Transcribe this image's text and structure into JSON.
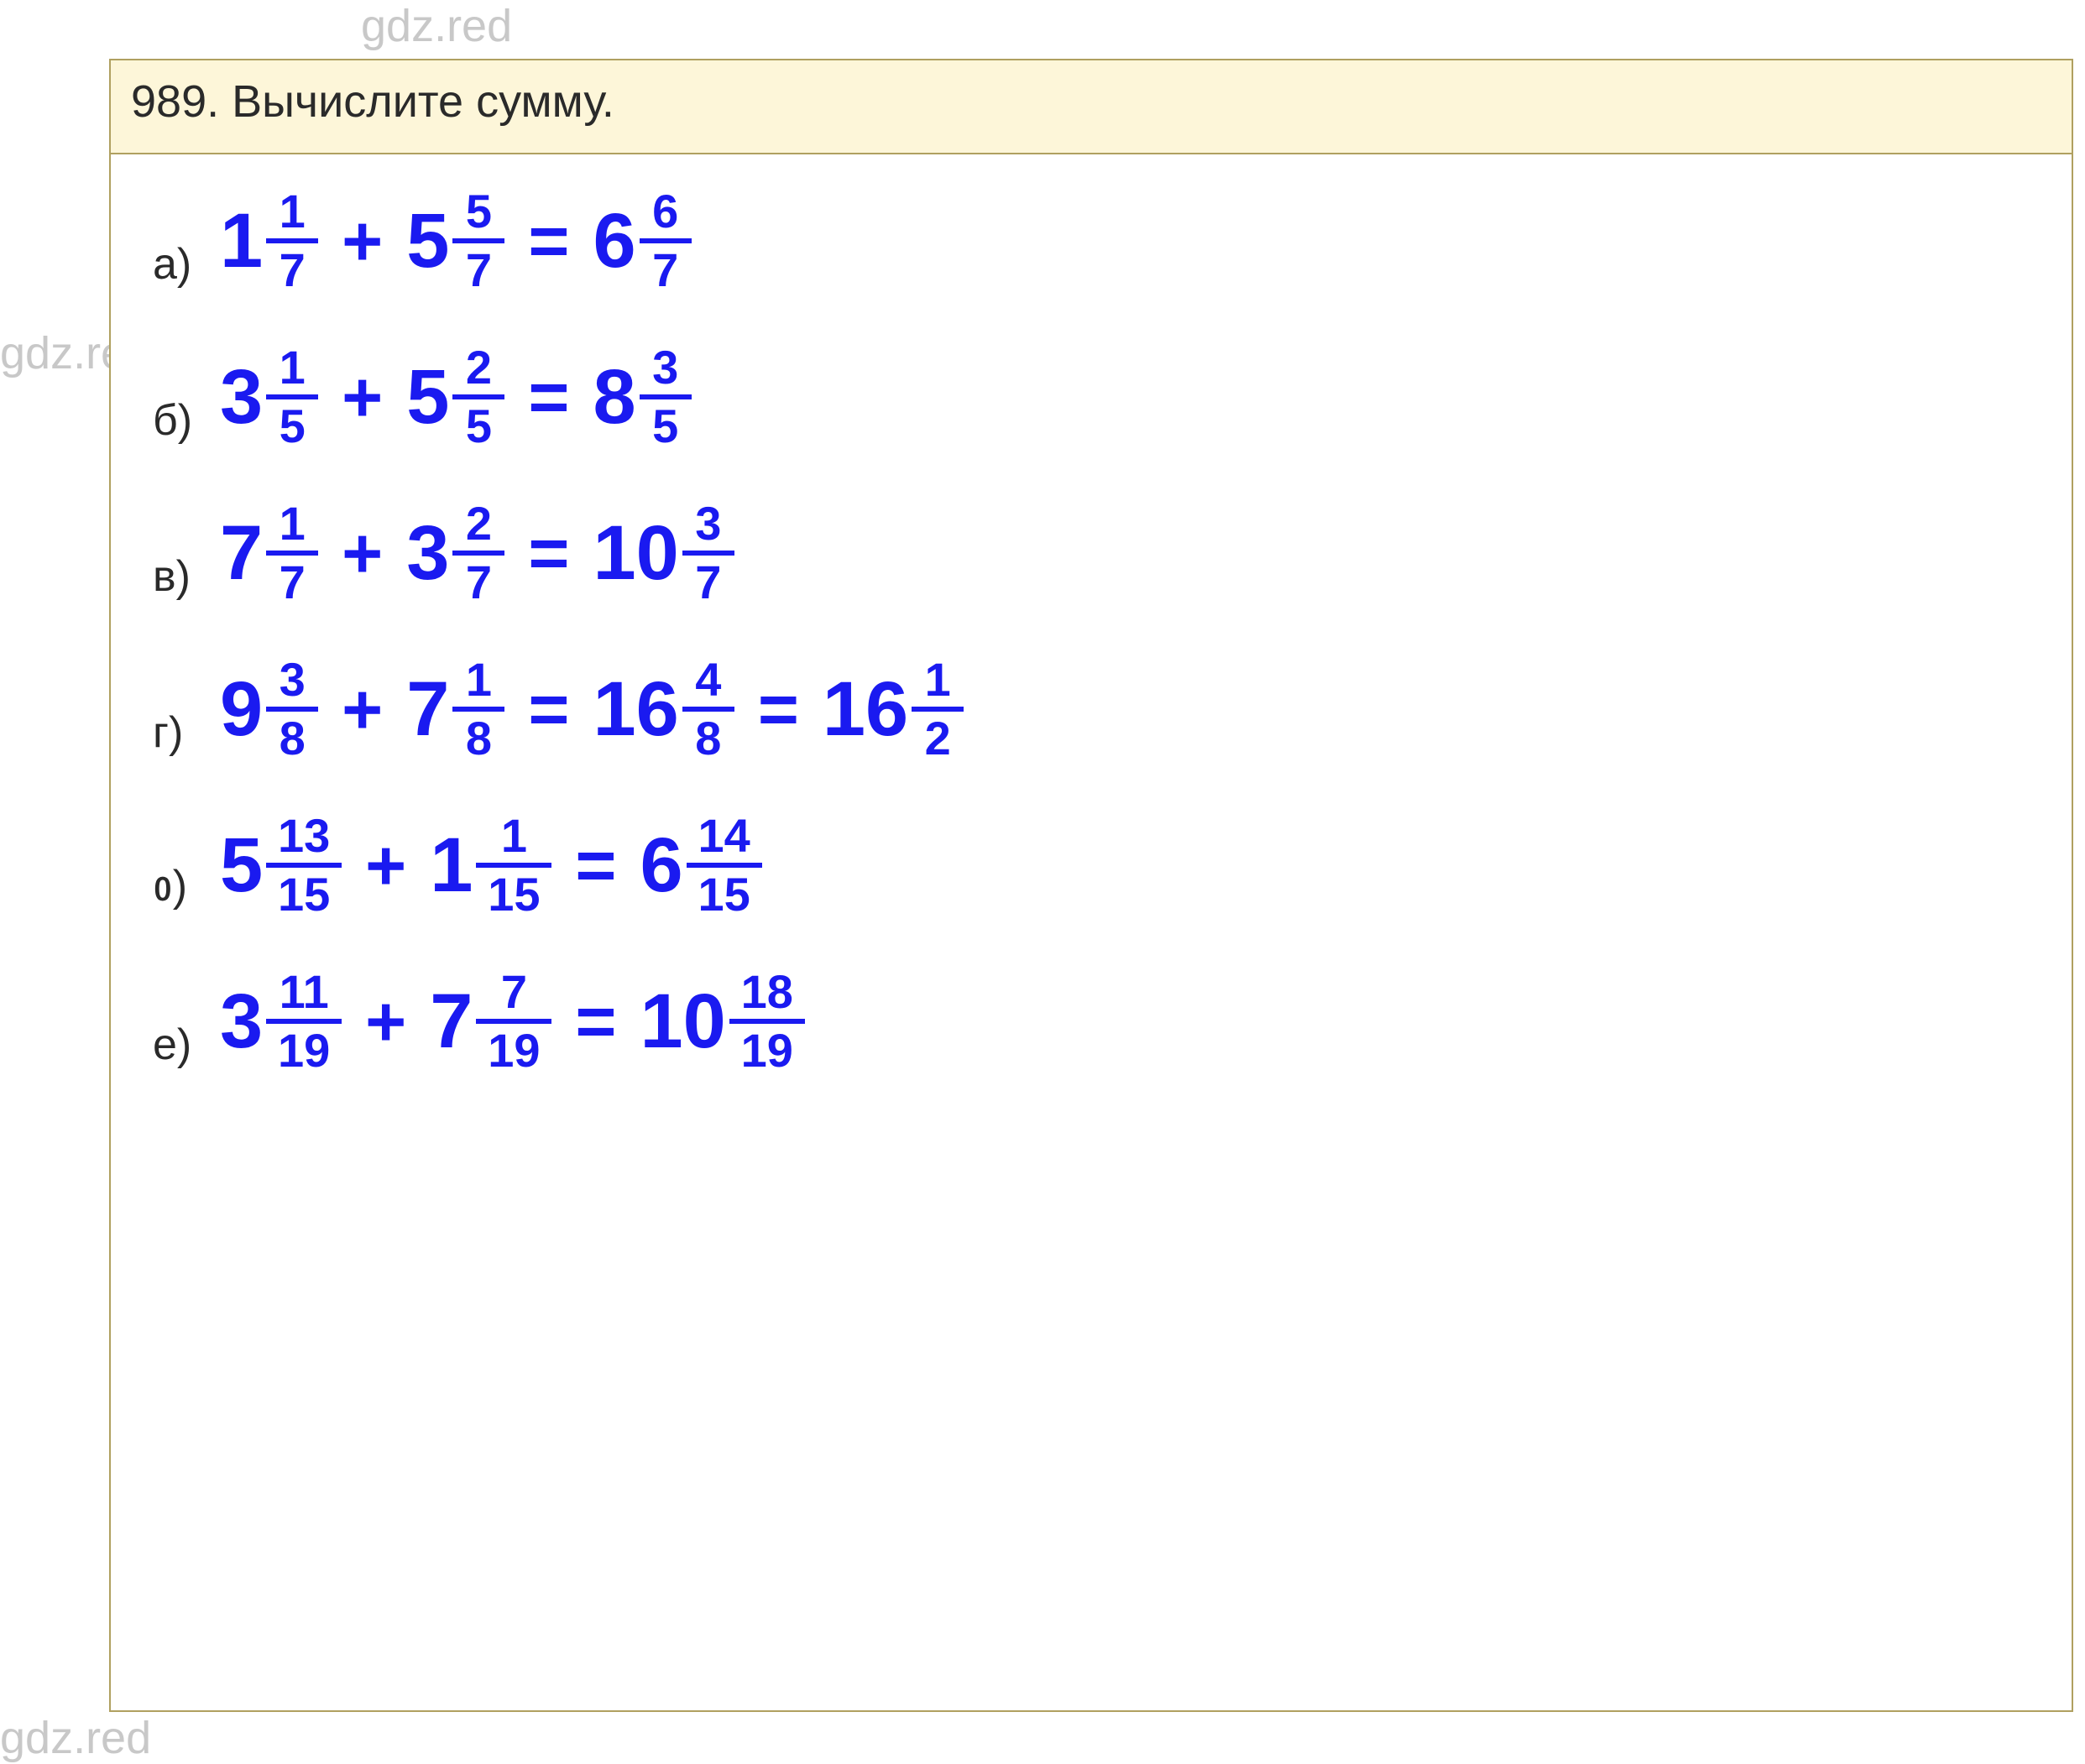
{
  "watermark": "gdz.red",
  "header": "989. Вычислите сумму.",
  "rows": [
    {
      "label": "а)",
      "terms": [
        {
          "whole": "1",
          "num": "1",
          "den": "7"
        },
        {
          "whole": "5",
          "num": "5",
          "den": "7"
        }
      ],
      "results": [
        {
          "whole": "6",
          "num": "6",
          "den": "7"
        }
      ]
    },
    {
      "label": "б)",
      "terms": [
        {
          "whole": "3",
          "num": "1",
          "den": "5"
        },
        {
          "whole": "5",
          "num": "2",
          "den": "5"
        }
      ],
      "results": [
        {
          "whole": "8",
          "num": "3",
          "den": "5"
        }
      ]
    },
    {
      "label": "в)",
      "terms": [
        {
          "whole": "7",
          "num": "1",
          "den": "7"
        },
        {
          "whole": "3",
          "num": "2",
          "den": "7"
        }
      ],
      "results": [
        {
          "whole": "10",
          "num": "3",
          "den": "7"
        }
      ]
    },
    {
      "label": "г)",
      "terms": [
        {
          "whole": "9",
          "num": "3",
          "den": "8"
        },
        {
          "whole": "7",
          "num": "1",
          "den": "8"
        }
      ],
      "results": [
        {
          "whole": "16",
          "num": "4",
          "den": "8"
        },
        {
          "whole": "16",
          "num": "1",
          "den": "2"
        }
      ]
    },
    {
      "label": "ᲂ)",
      "terms": [
        {
          "whole": "5",
          "num": "13",
          "den": "15"
        },
        {
          "whole": "1",
          "num": "1",
          "den": "15"
        }
      ],
      "results": [
        {
          "whole": "6",
          "num": "14",
          "den": "15"
        }
      ]
    },
    {
      "label": "е)",
      "terms": [
        {
          "whole": "3",
          "num": "11",
          "den": "19"
        },
        {
          "whole": "7",
          "num": "7",
          "den": "19"
        }
      ],
      "results": [
        {
          "whole": "10",
          "num": "18",
          "den": "19"
        }
      ]
    }
  ],
  "ops": {
    "plus": "+",
    "eq": "="
  }
}
